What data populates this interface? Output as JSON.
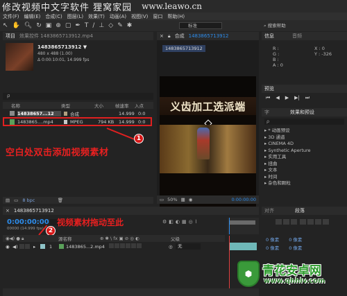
{
  "watermark": {
    "title": "修改视频中文字软件 狸窝家园",
    "url": "www.leawo.cn"
  },
  "menu": [
    "文件(F)",
    "编辑(E)",
    "合成(C)",
    "图层(L)",
    "效果(T)",
    "动画(A)",
    "视图(V)",
    "窗口",
    "帮助(H)"
  ],
  "toolbar": {
    "standard": "标准",
    "search_help": "搜索帮助"
  },
  "project": {
    "tab": "项目",
    "effects_tab": "效果控件 1483865713912.mp4",
    "clip_name": "1483865713912 ▼",
    "clip_info": "480 x 488 (1.00)",
    "clip_dur": "Δ 0:00:10:01, 14.999 fps",
    "search_placeholder": "ρ",
    "columns": [
      "名称",
      "类型",
      "大小",
      "帧速率",
      "入点"
    ],
    "rows": [
      {
        "name": "14838657...12",
        "type": "合成",
        "size": "",
        "fps": "14.999",
        "in": "0:0"
      },
      {
        "name": "1483865....mp4",
        "type": "MPEG",
        "size": "794 KB",
        "fps": "14.999",
        "in": "0:0"
      }
    ],
    "bpc": "8 bpc"
  },
  "composition": {
    "tab": "合成",
    "name": "1483865713912",
    "chip": "1483865713912",
    "zoom": "50%",
    "time": "0:00:00:00",
    "video_text": "义齿加工选派端"
  },
  "info": {
    "tab": "信息",
    "audio_tab": "音频",
    "r": "R :",
    "g": "G :",
    "b": "B :",
    "a": "A : 0",
    "x": "X : 0",
    "y": "Y : -326"
  },
  "preview": {
    "tab": "预览"
  },
  "effects": {
    "tab_char": "字",
    "tab": "效果和预设",
    "search": "ρ",
    "items": [
      "* 动画预设",
      "3D 通道",
      "CINEMA 4D",
      "Synthetic Aperture",
      "实用工具",
      "扭曲",
      "文本",
      "时间",
      "杂色和颗粒"
    ]
  },
  "annotations": {
    "one": "1",
    "one_text": "空白处双击添加视频素材",
    "two": "2",
    "two_text": "视频素材拖动至此"
  },
  "timeline": {
    "tab": "1483865713912",
    "timecode": "0:00:00:00",
    "fps": "00000 (14.999 fps)",
    "col_name": "源名称",
    "col_parent": "父级",
    "layer_num": "1",
    "layer_name": "1483865...2.mp4",
    "parent_value": "无"
  },
  "paragraph": {
    "tab1": "对齐",
    "tab2": "段落",
    "px": "0 像素",
    "px2": "0 像素"
  },
  "logo": {
    "name": "青花安卓网",
    "url": "www.qhhlv.com"
  }
}
